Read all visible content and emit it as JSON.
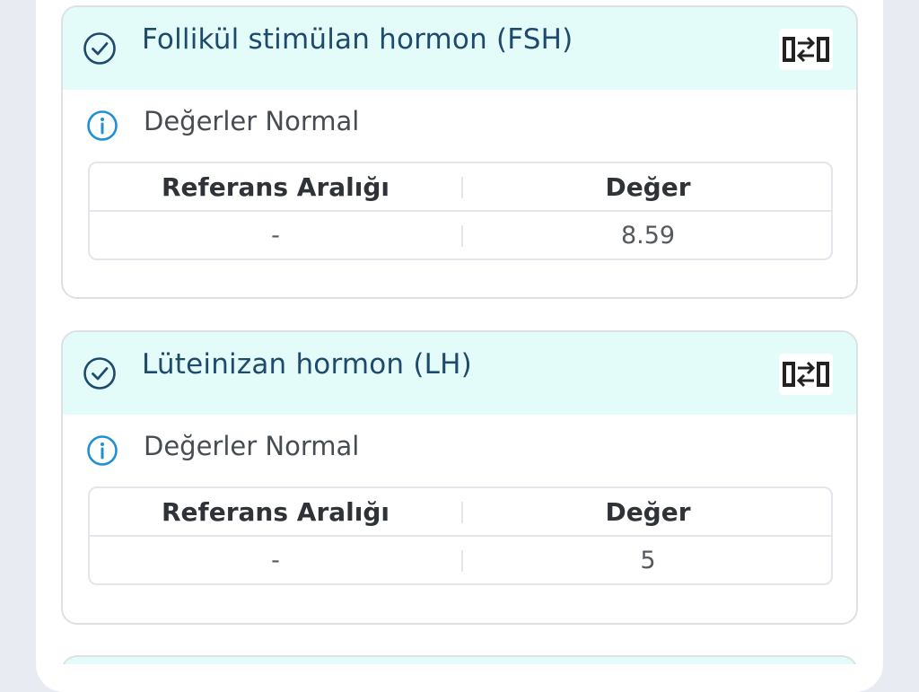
{
  "colors": {
    "header_bg": "#e3fbf9",
    "title_text": "#1e4a6b",
    "info_accent": "#1f8fd6",
    "page_bg": "#e9ebf2"
  },
  "cards": [
    {
      "title": "Follikül stimülan hormon (FSH)",
      "status_icon": "check-circle-icon",
      "action_icon": "compare-arrows-icon",
      "status_text": "Değerler Normal",
      "table": {
        "headers": [
          "Referans Aralığı",
          "Değer"
        ],
        "rows": [
          [
            "-",
            "8.59"
          ]
        ]
      }
    },
    {
      "title": "Lüteinizan hormon (LH)",
      "status_icon": "check-circle-icon",
      "action_icon": "compare-arrows-icon",
      "status_text": "Değerler Normal",
      "table": {
        "headers": [
          "Referans Aralığı",
          "Değer"
        ],
        "rows": [
          [
            "-",
            "5"
          ]
        ]
      }
    }
  ]
}
